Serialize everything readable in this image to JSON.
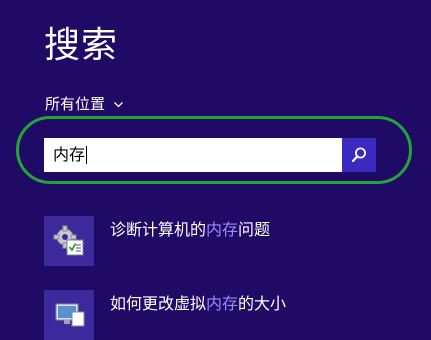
{
  "search_pane": {
    "title": "搜索",
    "scope_label": "所有位置",
    "query": "内存",
    "search_button_icon": "search-icon"
  },
  "results": [
    {
      "prefix": "诊断计算机的",
      "highlight": "内存",
      "suffix": "问题",
      "icon": "memory-diagnostic-icon"
    },
    {
      "prefix": "如何更改虚拟",
      "highlight": "内存",
      "suffix": "的大小",
      "icon": "system-settings-icon"
    }
  ],
  "colors": {
    "background": "#1f0a66",
    "search_button": "#3a2ac0",
    "highlight_text": "#9f87ff",
    "annotation_ring": "#25a338"
  }
}
